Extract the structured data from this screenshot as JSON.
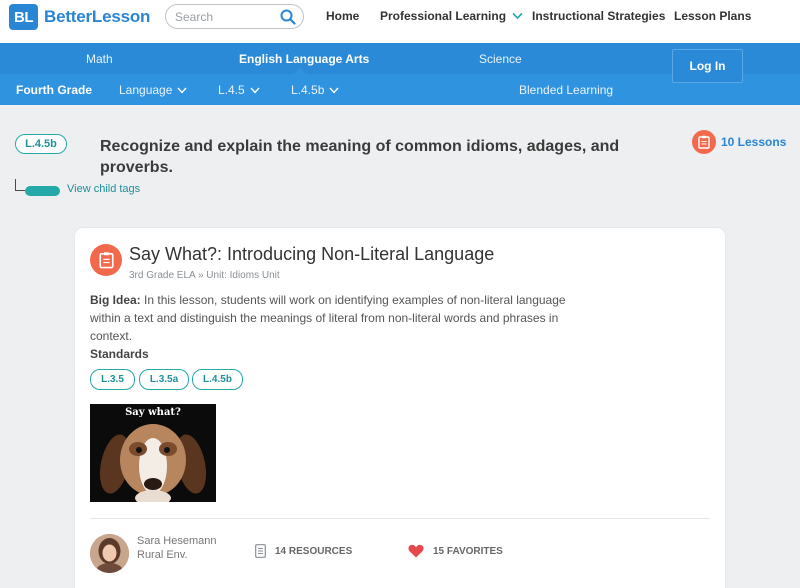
{
  "header": {
    "logo_mark": "BL",
    "logo_text": "BetterLesson",
    "search_placeholder": "Search",
    "nav": [
      "Home",
      "Professional Learning",
      "Instructional Strategies",
      "Lesson Plans"
    ]
  },
  "subjects": {
    "items": [
      "Math",
      "English Language Arts",
      "Science"
    ],
    "active": "English Language Arts"
  },
  "login_label": "Log In",
  "breadcrumb": {
    "grade": "Fourth Grade",
    "items": [
      "Language",
      "L.4.5",
      "L.4.5b"
    ],
    "blended": "Blended Learning"
  },
  "standard": {
    "code": "L.4.5b",
    "title": "Recognize and explain the meaning of common idioms, adages, and proverbs.",
    "child_tags_label": "View child tags",
    "lessons_count": "10 Lessons"
  },
  "lesson": {
    "title": "Say What?: Introducing Non-Literal Language",
    "grade": "3rd Grade ELA",
    "unit_prefix": "Unit:",
    "unit": "Idioms Unit",
    "big_idea_label": "Big Idea:",
    "big_idea": "In this lesson, students will work on identifying examples of non-literal language within a text and distinguish the meanings of literal from non-literal words and phrases in context.",
    "standards_label": "Standards",
    "standards": [
      "L.3.5",
      "L.3.5a",
      "L.4.5b"
    ],
    "image_caption": "Say what?",
    "author_name": "Sara Hesemann",
    "author_school": "Rural Env.",
    "resources": "14 RESOURCES",
    "favorites": "15 FAVORITES"
  },
  "colors": {
    "brand_blue": "#2a85d4",
    "nav_blue": "#2a8ad8",
    "crumb_blue": "#2f93e0",
    "teal": "#25a8a8",
    "lesson_orange": "#f26a4b",
    "favorite_red": "#e5484d"
  }
}
